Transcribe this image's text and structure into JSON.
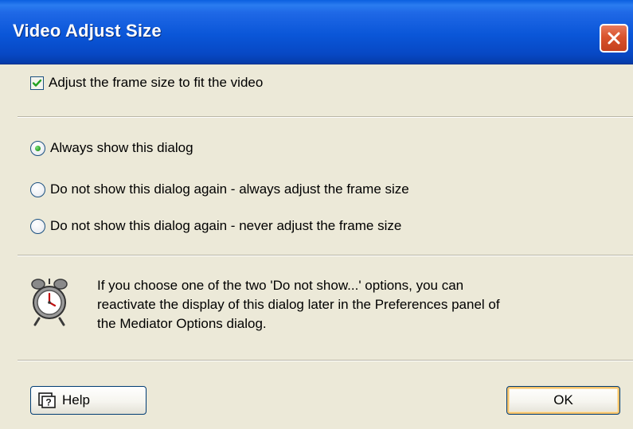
{
  "window": {
    "title": "Video Adjust Size"
  },
  "checkbox": {
    "label": "Adjust the frame size to fit the video",
    "checked": true
  },
  "options": [
    {
      "label": "Always show this dialog",
      "selected": true
    },
    {
      "label": "Do not show this dialog again - always adjust the frame size",
      "selected": false
    },
    {
      "label": "Do not show this dialog again - never adjust the frame size",
      "selected": false
    }
  ],
  "info": {
    "icon": "alarm-clock-icon",
    "lines": [
      "If you choose one of the two 'Do not show...' options, you can",
      "reactivate the display of this dialog later in the Preferences panel of",
      "the Mediator Options dialog."
    ]
  },
  "buttons": {
    "help_label": "Help",
    "ok_label": "OK"
  },
  "colors": {
    "titlebar": "#0a56d8",
    "dialog_bg": "#ece9d8",
    "close": "#d9532d"
  }
}
